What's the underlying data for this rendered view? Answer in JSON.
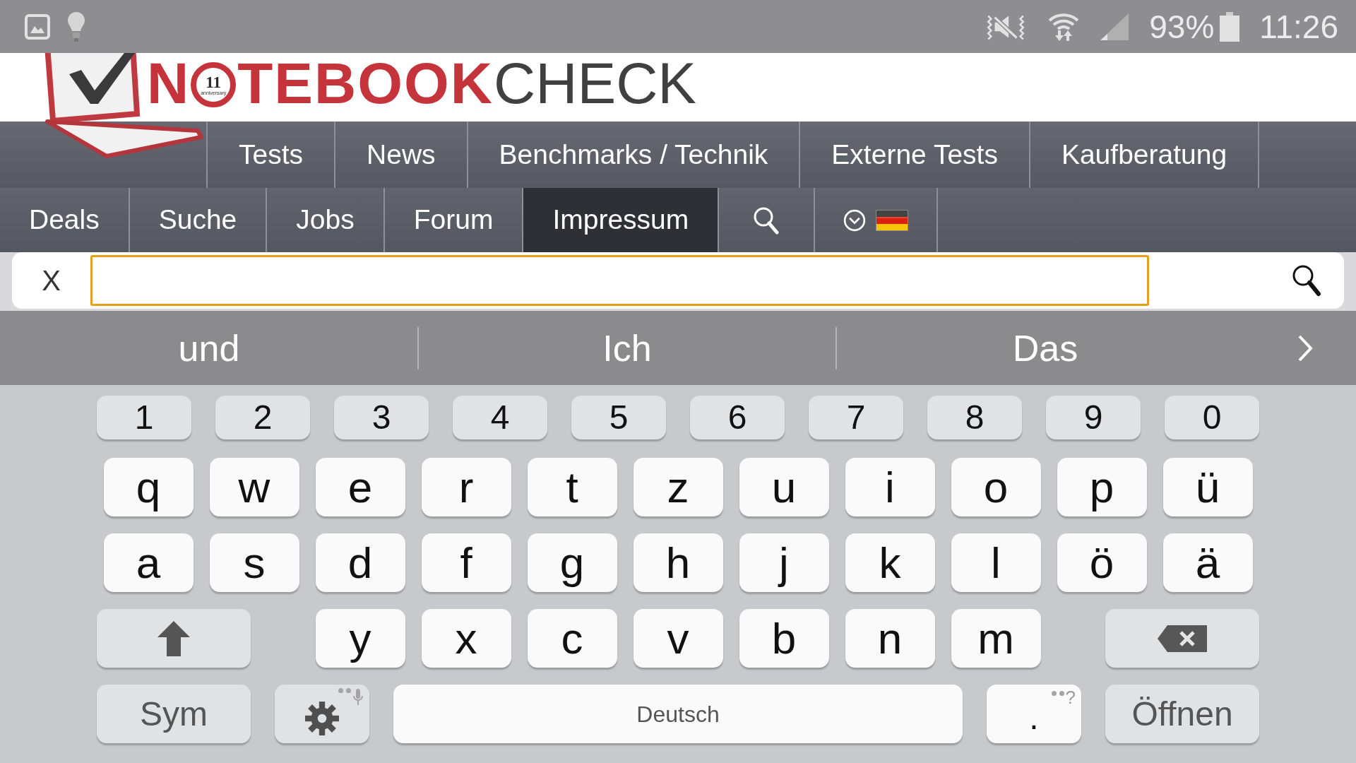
{
  "status_bar": {
    "battery": "93%",
    "time": "11:26"
  },
  "logo": {
    "lead": "N",
    "badge_number": "11",
    "badge_caption": "anniversary",
    "middle": "TEBOOK",
    "tail": "CHECK"
  },
  "main_nav": [
    {
      "label": "Tests",
      "selected": false
    },
    {
      "label": "News",
      "selected": false
    },
    {
      "label": "Benchmarks / Technik",
      "selected": false
    },
    {
      "label": "Externe Tests",
      "selected": false
    },
    {
      "label": "Kaufberatung",
      "selected": false
    }
  ],
  "sub_nav": [
    {
      "kind": "link",
      "label": "Deals",
      "selected": false
    },
    {
      "kind": "link",
      "label": "Suche",
      "selected": false
    },
    {
      "kind": "link",
      "label": "Jobs",
      "selected": false
    },
    {
      "kind": "link",
      "label": "Forum",
      "selected": false
    },
    {
      "kind": "link",
      "label": "Impressum",
      "selected": true
    },
    {
      "kind": "search",
      "selected": false
    },
    {
      "kind": "language",
      "selected": false
    }
  ],
  "search_bar": {
    "clear": "X",
    "focused": true
  },
  "suggestions": [
    "und",
    "Ich",
    "Das"
  ],
  "keyboard": {
    "number_row": [
      {
        "kind": "number",
        "label": "1"
      },
      {
        "kind": "number",
        "label": "2"
      },
      {
        "kind": "number",
        "label": "3"
      },
      {
        "kind": "number",
        "label": "4"
      },
      {
        "kind": "number",
        "label": "5"
      },
      {
        "kind": "number",
        "label": "6"
      },
      {
        "kind": "number",
        "label": "7"
      },
      {
        "kind": "number",
        "label": "8"
      },
      {
        "kind": "number",
        "label": "9"
      },
      {
        "kind": "number",
        "label": "0"
      }
    ],
    "upper_row": [
      {
        "kind": "letter",
        "label": "q"
      },
      {
        "kind": "letter",
        "label": "w"
      },
      {
        "kind": "letter",
        "label": "e"
      },
      {
        "kind": "letter",
        "label": "r"
      },
      {
        "kind": "letter",
        "label": "t"
      },
      {
        "kind": "letter",
        "label": "z"
      },
      {
        "kind": "letter",
        "label": "u"
      },
      {
        "kind": "letter",
        "label": "i"
      },
      {
        "kind": "letter",
        "label": "o"
      },
      {
        "kind": "letter",
        "label": "p"
      },
      {
        "kind": "letter",
        "label": "ü"
      }
    ],
    "middle_row": [
      {
        "kind": "letter",
        "label": "a"
      },
      {
        "kind": "letter",
        "label": "s"
      },
      {
        "kind": "letter",
        "label": "d"
      },
      {
        "kind": "letter",
        "label": "f"
      },
      {
        "kind": "letter",
        "label": "g"
      },
      {
        "kind": "letter",
        "label": "h"
      },
      {
        "kind": "letter",
        "label": "j"
      },
      {
        "kind": "letter",
        "label": "k"
      },
      {
        "kind": "letter",
        "label": "l"
      },
      {
        "kind": "letter",
        "label": "ö"
      },
      {
        "kind": "letter",
        "label": "ä"
      }
    ],
    "lower_row": [
      {
        "kind": "shift"
      },
      {
        "kind": "letter",
        "label": "y"
      },
      {
        "kind": "letter",
        "label": "x"
      },
      {
        "kind": "letter",
        "label": "c"
      },
      {
        "kind": "letter",
        "label": "v"
      },
      {
        "kind": "letter",
        "label": "b"
      },
      {
        "kind": "letter",
        "label": "n"
      },
      {
        "kind": "letter",
        "label": "m"
      },
      {
        "kind": "backspace"
      }
    ],
    "bottom_row": [
      {
        "kind": "function",
        "label": "Sym"
      },
      {
        "kind": "settings"
      },
      {
        "kind": "space",
        "label": "Deutsch"
      },
      {
        "kind": "period",
        "label": ".",
        "hint": "?"
      },
      {
        "kind": "function",
        "label": "Öffnen"
      }
    ]
  }
}
